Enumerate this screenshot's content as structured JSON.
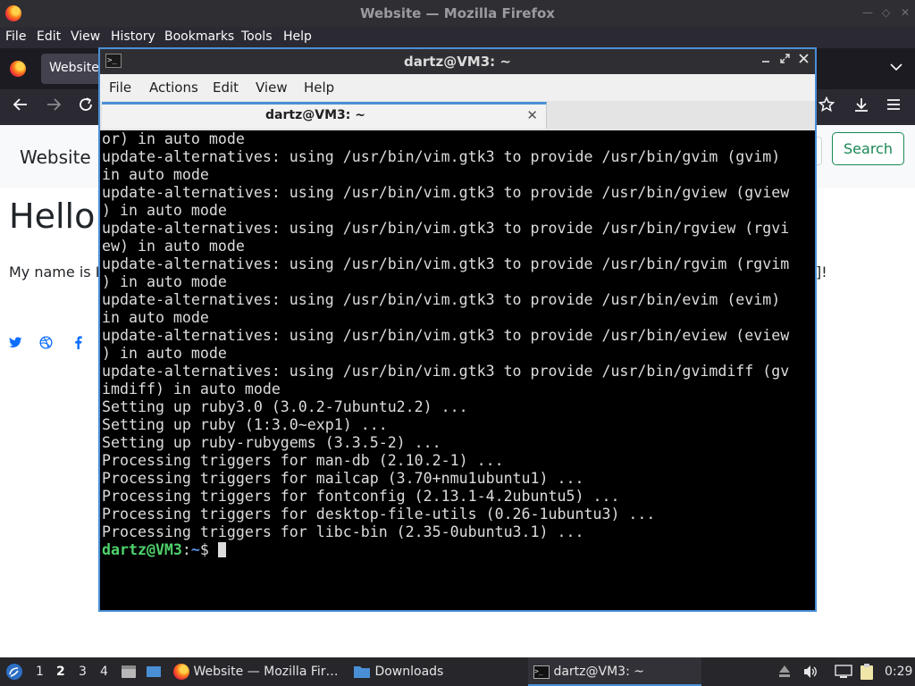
{
  "firefox": {
    "window_title": "Website — Mozilla Firefox",
    "menu": [
      "File",
      "Edit",
      "View",
      "History",
      "Bookmarks",
      "Tools",
      "Help"
    ],
    "tab_label": "Website",
    "page": {
      "brand": "Website",
      "search_button": "Search",
      "heading": "Hello",
      "intro_start": "My name is I",
      "intro_end": "]!",
      "social_icons": [
        "twitter-icon",
        "dribbble-icon",
        "facebook-icon"
      ]
    }
  },
  "terminal": {
    "window_title": "dartz@VM3: ~",
    "menu": [
      "File",
      "Actions",
      "Edit",
      "View",
      "Help"
    ],
    "tab_label": "dartz@VM3: ~",
    "lines": [
      "or) in auto mode",
      "update-alternatives: using /usr/bin/vim.gtk3 to provide /usr/bin/gvim (gvim)",
      "in auto mode",
      "update-alternatives: using /usr/bin/vim.gtk3 to provide /usr/bin/gview (gview",
      ") in auto mode",
      "update-alternatives: using /usr/bin/vim.gtk3 to provide /usr/bin/rgview (rgvi",
      "ew) in auto mode",
      "update-alternatives: using /usr/bin/vim.gtk3 to provide /usr/bin/rgvim (rgvim",
      ") in auto mode",
      "update-alternatives: using /usr/bin/vim.gtk3 to provide /usr/bin/evim (evim)",
      "in auto mode",
      "update-alternatives: using /usr/bin/vim.gtk3 to provide /usr/bin/eview (eview",
      ") in auto mode",
      "update-alternatives: using /usr/bin/vim.gtk3 to provide /usr/bin/gvimdiff (gv",
      "imdiff) in auto mode",
      "Setting up ruby3.0 (3.0.2-7ubuntu2.2) ...",
      "Setting up ruby (1:3.0~exp1) ...",
      "Setting up ruby-rubygems (3.3.5-2) ...",
      "Processing triggers for man-db (2.10.2-1) ...",
      "Processing triggers for mailcap (3.70+nmu1ubuntu1) ...",
      "Processing triggers for fontconfig (2.13.1-4.2ubuntu5) ...",
      "Processing triggers for desktop-file-utils (0.26-1ubuntu3) ...",
      "Processing triggers for libc-bin (2.35-0ubuntu3.1) ..."
    ],
    "prompt": {
      "user_host": "dartz@VM3",
      "separator": ":",
      "path": "~",
      "symbol": "$ "
    }
  },
  "taskbar": {
    "workspaces": [
      "1",
      "2",
      "3",
      "4"
    ],
    "active_workspace": "2",
    "tasks": [
      {
        "label": "Website — Mozilla Fir…",
        "icon": "firefox-icon"
      },
      {
        "label": "Downloads",
        "icon": "folder-icon"
      },
      {
        "label": "dartz@VM3: ~",
        "icon": "terminal-icon"
      }
    ],
    "clock": "0:29"
  }
}
